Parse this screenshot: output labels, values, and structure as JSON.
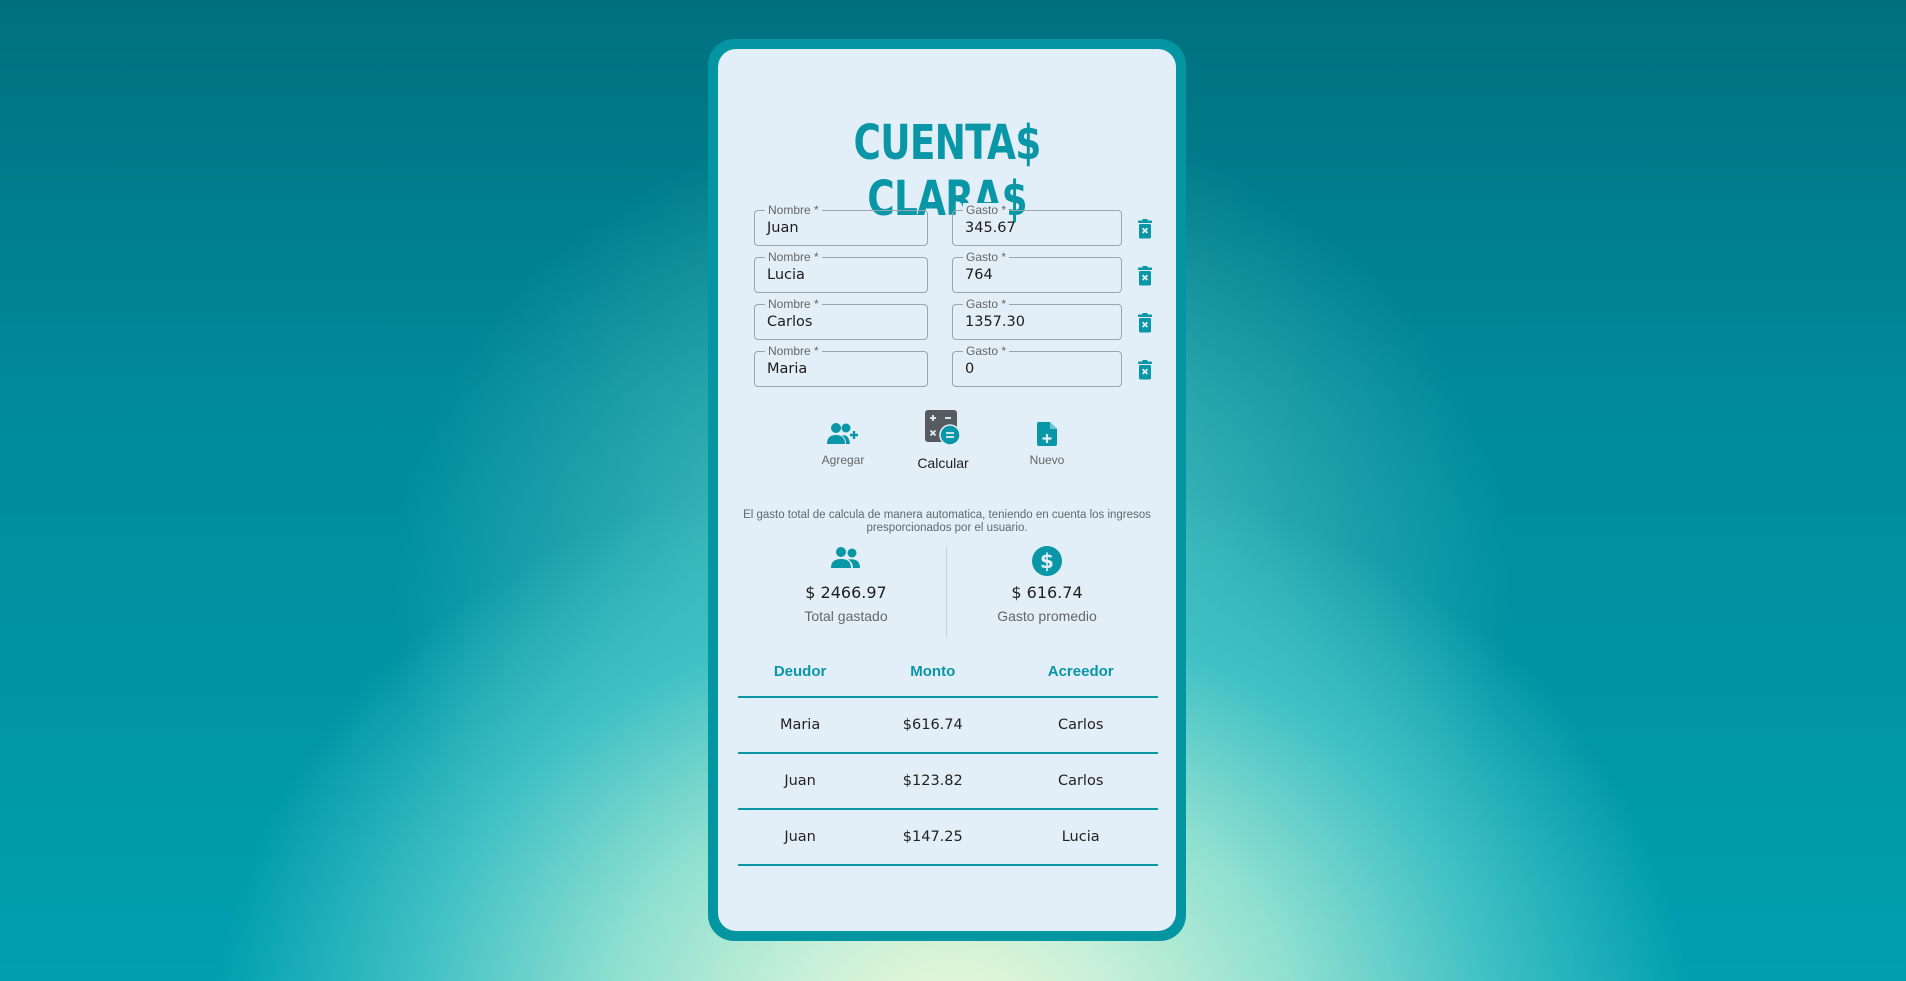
{
  "app": {
    "title": "CUENTA$ CLARA$"
  },
  "colors": {
    "accent": "#0996a6",
    "frame": "#0396a2",
    "screen": "#e3eff8"
  },
  "form": {
    "name_label": "Nombre *",
    "gasto_label": "Gasto *",
    "rows": [
      {
        "name": "Juan",
        "gasto": "345.67"
      },
      {
        "name": "Lucia",
        "gasto": "764"
      },
      {
        "name": "Carlos",
        "gasto": "1357.30"
      },
      {
        "name": "Maria",
        "gasto": "0"
      }
    ]
  },
  "actions": {
    "add_label": "Agregar",
    "calc_label": "Calcular",
    "new_label": "Nuevo"
  },
  "note": "El gasto total de calcula de manera automatica, teniendo en cuenta los ingresos presporcionados por el usuario.",
  "stats": {
    "total_value": "$ 2466.97",
    "total_label": "Total gastado",
    "avg_value": "$ 616.74",
    "avg_label": "Gasto promedio"
  },
  "table": {
    "headers": [
      "Deudor",
      "Monto",
      "Acreedor"
    ],
    "rows": [
      [
        "Maria",
        "$616.74",
        "Carlos"
      ],
      [
        "Juan",
        "$123.82",
        "Carlos"
      ],
      [
        "Juan",
        "$147.25",
        "Lucia"
      ]
    ]
  }
}
